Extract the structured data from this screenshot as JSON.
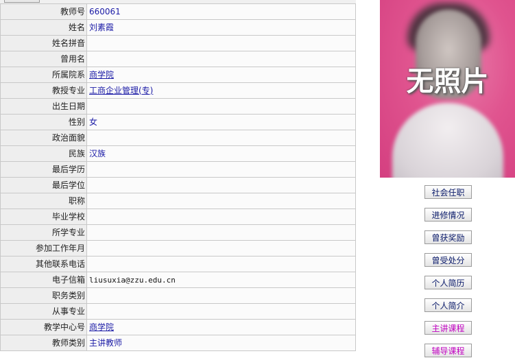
{
  "teacher_info": [
    {
      "label": "教师号",
      "value": "660061",
      "link": false
    },
    {
      "label": "姓名",
      "value": "刘素霞",
      "link": false
    },
    {
      "label": "姓名拼音",
      "value": "",
      "link": false
    },
    {
      "label": "曾用名",
      "value": "",
      "link": false
    },
    {
      "label": "所属院系",
      "value": "商学院",
      "link": true
    },
    {
      "label": "教授专业",
      "value": "工商企业管理(专)",
      "link": true
    },
    {
      "label": "出生日期",
      "value": "",
      "link": false
    },
    {
      "label": "性别",
      "value": "女",
      "link": false
    },
    {
      "label": "政治面貌",
      "value": "",
      "link": false
    },
    {
      "label": "民族",
      "value": "汉族",
      "link": false
    },
    {
      "label": "最后学历",
      "value": "",
      "link": false
    },
    {
      "label": "最后学位",
      "value": "",
      "link": false
    },
    {
      "label": "职称",
      "value": "",
      "link": false
    },
    {
      "label": "毕业学校",
      "value": "",
      "link": false
    },
    {
      "label": "所学专业",
      "value": "",
      "link": false
    },
    {
      "label": "参加工作年月",
      "value": "",
      "link": false
    },
    {
      "label": "其他联系电话",
      "value": "",
      "link": false
    },
    {
      "label": "电子信箱",
      "value": "liusuxia@zzu.edu.cn",
      "link": false
    },
    {
      "label": "职务类别",
      "value": "",
      "link": false
    },
    {
      "label": "从事专业",
      "value": "",
      "link": false
    },
    {
      "label": "教学中心号",
      "value": "商学院",
      "link": true
    },
    {
      "label": "教师类别",
      "value": "主讲教师",
      "link": false
    }
  ],
  "photo": {
    "placeholder_text": "无照片"
  },
  "side_buttons": [
    {
      "label": "社会任职",
      "highlight": false
    },
    {
      "label": "进修情况",
      "highlight": false
    },
    {
      "label": "曾获奖励",
      "highlight": false
    },
    {
      "label": "曾受处分",
      "highlight": false
    },
    {
      "label": "个人简历",
      "highlight": false
    },
    {
      "label": "个人简介",
      "highlight": false
    },
    {
      "label": "主讲课程",
      "highlight": true
    },
    {
      "label": "辅导课程",
      "highlight": true
    }
  ],
  "colors": {
    "value_text": "#1a1aa6",
    "highlight_button_text": "#c000c0",
    "photo_background": "#e0548f"
  }
}
